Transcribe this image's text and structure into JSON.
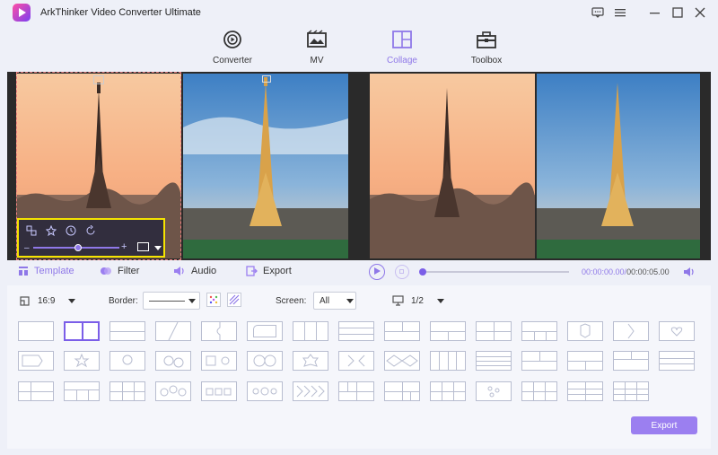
{
  "app": {
    "title": "ArkThinker Video Converter Ultimate"
  },
  "nav": [
    {
      "label": "Converter",
      "icon": "converter-icon"
    },
    {
      "label": "MV",
      "icon": "mv-icon"
    },
    {
      "label": "Collage",
      "icon": "collage-icon",
      "active": true
    },
    {
      "label": "Toolbox",
      "icon": "toolbox-icon"
    }
  ],
  "tabs": [
    {
      "label": "Template",
      "icon": "template-icon",
      "active": true
    },
    {
      "label": "Filter",
      "icon": "filter-icon"
    },
    {
      "label": "Audio",
      "icon": "audio-icon"
    },
    {
      "label": "Export",
      "icon": "export-icon"
    }
  ],
  "playback": {
    "current": "00:00:00.00",
    "separator": "/",
    "total": "00:00:05.00",
    "progress": 0
  },
  "controls": {
    "aspect": "16:9",
    "border_label": "Border:",
    "screen_label": "Screen:",
    "screen_value": "All",
    "page": "1/2"
  },
  "export_button": "Export",
  "colors": {
    "accent": "#8f78e8",
    "highlight": "#f5e400",
    "button": "#9b7ff0"
  }
}
